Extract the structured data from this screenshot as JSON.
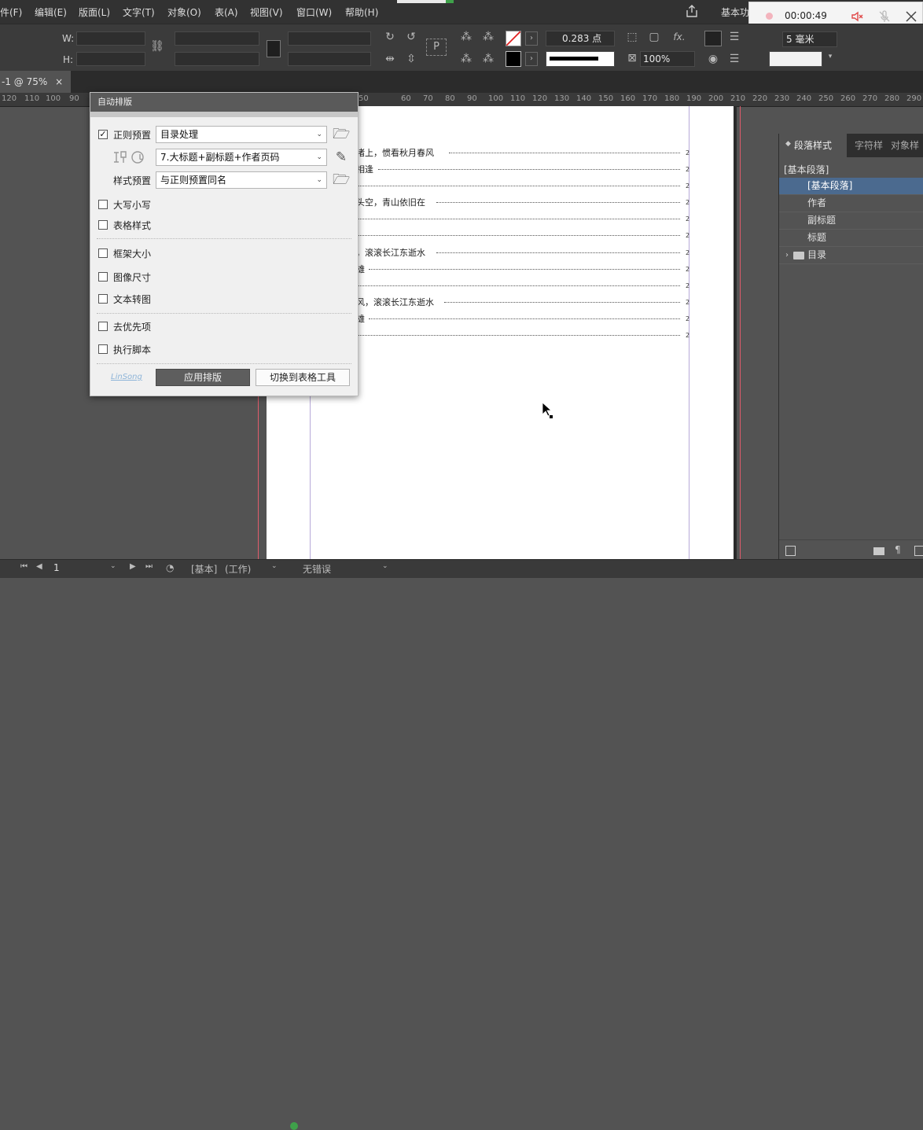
{
  "menu": {
    "items": [
      "件(F)",
      "编辑(E)",
      "版面(L)",
      "文字(T)",
      "对象(O)",
      "表(A)",
      "视图(V)",
      "窗口(W)",
      "帮助(H)"
    ],
    "workspace_label": "基本功"
  },
  "recorder": {
    "time": "00:00:49"
  },
  "control_bar": {
    "w_label": "W:",
    "h_label": "H:",
    "stroke_weight": "0.283 点",
    "scale_percent": "100%",
    "spacing_value": "5 毫米"
  },
  "document_tab": {
    "label": "-1 @ 75%",
    "close": "×"
  },
  "ruler": {
    "labels": [
      "120",
      "110",
      "100",
      "90",
      "50",
      "60",
      "70",
      "80",
      "90",
      "100",
      "110",
      "120",
      "130",
      "140",
      "150",
      "160",
      "170",
      "180",
      "190",
      "200",
      "210",
      "220",
      "230",
      "240",
      "250",
      "260",
      "270",
      "280",
      "290"
    ]
  },
  "document": {
    "toc_entries": [
      {
        "text": "渚上，惯看秋月春风",
        "page": "2"
      },
      {
        "text": "相逢",
        "page": "2"
      },
      {
        "text": "",
        "page": "2"
      },
      {
        "text": "头空，青山依旧在",
        "page": "2"
      },
      {
        "text": "",
        "page": "2"
      },
      {
        "text": "",
        "page": "2"
      },
      {
        "text": "，滚滚长江东逝水",
        "page": "2"
      },
      {
        "text": "雄",
        "page": "2"
      },
      {
        "text": "",
        "page": "2"
      },
      {
        "text": "风，滚滚长江东逝水",
        "page": "2"
      },
      {
        "text": "雄",
        "page": "2"
      },
      {
        "text": "",
        "page": "2"
      }
    ]
  },
  "auto_layout_panel": {
    "title": "自动排版",
    "regex_preset": {
      "label": "正则预置",
      "checked": true,
      "value": "目录处理"
    },
    "replace_preset": {
      "value": "7.大标题+副标题+作者页码"
    },
    "style_preset": {
      "label": "样式预置",
      "value": "与正则预置同名"
    },
    "options": [
      {
        "label": "大写小写",
        "checked": false
      },
      {
        "label": "表格样式",
        "checked": false
      },
      {
        "label": "框架大小",
        "checked": false
      },
      {
        "label": "图像尺寸",
        "checked": false
      },
      {
        "label": "文本转图",
        "checked": false
      },
      {
        "label": "去优先项",
        "checked": false
      },
      {
        "label": "执行脚本",
        "checked": false
      }
    ],
    "author_link": "LinSong",
    "apply_button": "应用排版",
    "switch_button": "切换到表格工具",
    "check_mark": "✓",
    "folder_icon": "🗁",
    "edit_icon": "✎",
    "dropdown_arrow": "⌄"
  },
  "paragraph_styles_panel": {
    "tabs": [
      "段落样式",
      "字符样",
      "对象样"
    ],
    "current_style": "[基本段落]",
    "styles": [
      "[基本段落]",
      "作者",
      "副标题",
      "标题"
    ],
    "group": "目录"
  },
  "status_bar": {
    "page_number": "1",
    "master": "[基本]",
    "mode": "(工作)",
    "preflight": "无错误"
  },
  "colors": {
    "accent_selected": "#4b6a8f",
    "guide_red": "#e15b6b",
    "preflight_green": "#3fa14a"
  }
}
